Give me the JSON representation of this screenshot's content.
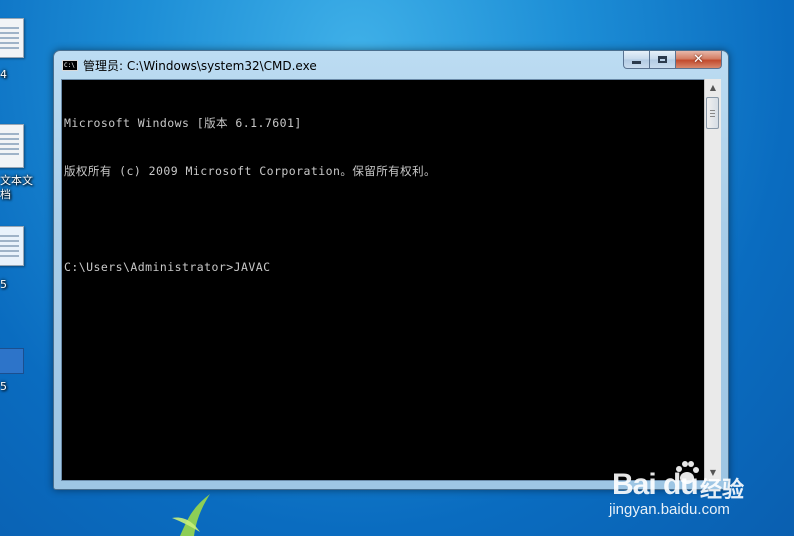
{
  "desktop": {
    "icons": [
      {
        "label": "4",
        "kind": "doc"
      },
      {
        "label": "文本文\n档",
        "kind": "doc"
      },
      {
        "label": "5",
        "kind": "doc"
      },
      {
        "label": "5",
        "kind": "blue"
      }
    ]
  },
  "window": {
    "title": "管理员: C:\\Windows\\system32\\CMD.exe",
    "icon_text": "C:\\",
    "controls": {
      "minimize": "minimize-icon",
      "maximize": "maximize-icon",
      "close": "close-icon"
    }
  },
  "console": {
    "lines": [
      "Microsoft Windows [版本 6.1.7601]",
      "版权所有 (c) 2009 Microsoft Corporation。保留所有权利。",
      "",
      "C:\\Users\\Administrator>JAVAC"
    ]
  },
  "watermark": {
    "logo": "Bai du",
    "cn": "经验",
    "url": "jingyan.baidu.com"
  },
  "colors": {
    "console_bg": "#000000",
    "console_fg": "#c8c8c8",
    "desktop_bg": "#1d8ed6"
  }
}
